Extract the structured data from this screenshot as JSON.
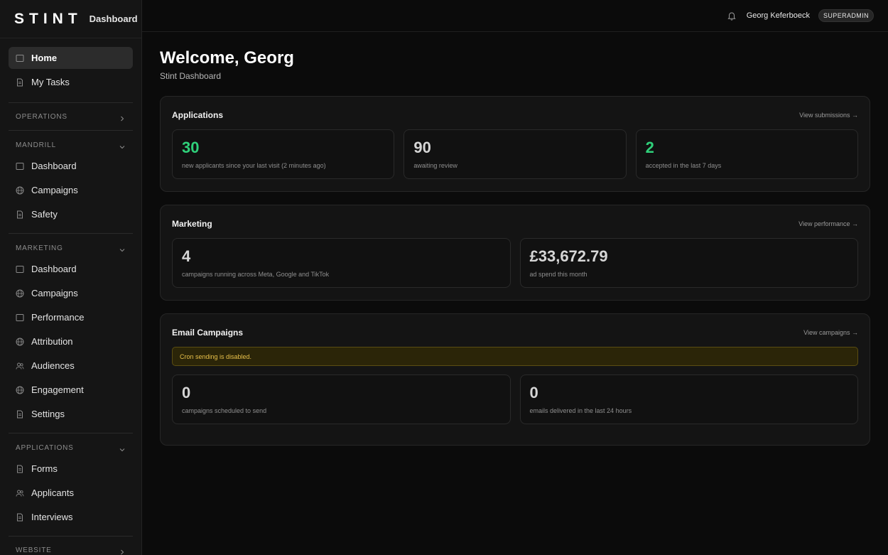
{
  "brand": {
    "logo": "STINT",
    "section": "Dashboard"
  },
  "sidebar": {
    "top_items": [
      {
        "label": "Home",
        "icon": "square-icon",
        "active": true
      },
      {
        "label": "My Tasks",
        "icon": "document-icon",
        "active": false
      }
    ],
    "operations": {
      "title": "OPERATIONS"
    },
    "mandrill": {
      "title": "MANDRILL",
      "items": [
        {
          "label": "Dashboard",
          "icon": "square-icon"
        },
        {
          "label": "Campaigns",
          "icon": "globe-icon"
        },
        {
          "label": "Safety",
          "icon": "document-icon"
        }
      ]
    },
    "marketing": {
      "title": "MARKETING",
      "items": [
        {
          "label": "Dashboard",
          "icon": "square-icon"
        },
        {
          "label": "Campaigns",
          "icon": "globe-icon"
        },
        {
          "label": "Performance",
          "icon": "square-icon"
        },
        {
          "label": "Attribution",
          "icon": "globe-icon"
        },
        {
          "label": "Audiences",
          "icon": "users-icon"
        },
        {
          "label": "Engagement",
          "icon": "globe-icon"
        },
        {
          "label": "Settings",
          "icon": "document-icon"
        }
      ]
    },
    "applications": {
      "title": "APPLICATIONS",
      "items": [
        {
          "label": "Forms",
          "icon": "document-icon"
        },
        {
          "label": "Applicants",
          "icon": "users-icon"
        },
        {
          "label": "Interviews",
          "icon": "document-icon"
        }
      ]
    },
    "website": {
      "title": "WEBSITE"
    }
  },
  "header": {
    "username": "Georg Keferboeck",
    "role": "SUPERADMIN"
  },
  "main": {
    "welcome": "Welcome, Georg",
    "subtitle": "Stint Dashboard",
    "applications": {
      "title": "Applications",
      "link": "View submissions →",
      "stats": [
        {
          "value": "30",
          "desc": "new applicants since your last visit (2 minutes ago)"
        },
        {
          "value": "90",
          "desc": "awaiting review"
        },
        {
          "value": "2",
          "desc": "accepted in the last 7 days"
        }
      ]
    },
    "marketing": {
      "title": "Marketing",
      "link": "View performance →",
      "stats": [
        {
          "value": "4",
          "desc": "campaigns running across Meta, Google and TikTok"
        },
        {
          "value": "£33,672.79",
          "desc": "ad spend this month"
        }
      ]
    },
    "email": {
      "title": "Email Campaigns",
      "link": "View campaigns →",
      "alert": "Cron sending is disabled.",
      "stats": [
        {
          "value": "0",
          "desc": "campaigns scheduled to send"
        },
        {
          "value": "0",
          "desc": "emails delivered in the last 24 hours"
        }
      ]
    }
  },
  "colors": {
    "accent_green": "#2fd07a",
    "alert_text": "#e8c04a",
    "alert_bg": "#2b2508"
  }
}
